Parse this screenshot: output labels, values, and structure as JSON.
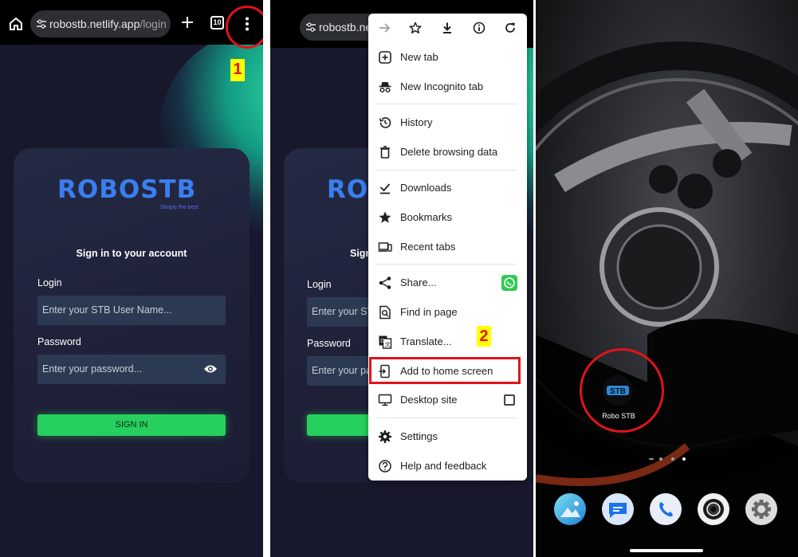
{
  "panel1": {
    "url_host": "robostb.netlify.app",
    "url_path": "/login",
    "tab_count": "10",
    "step_number": "1",
    "logo_text": "ROBOSTB",
    "tagline": "Simply the best",
    "signin_title": "Sign in to your account",
    "login_label": "Login",
    "login_placeholder": "Enter your STB User Name...",
    "password_label": "Password",
    "password_placeholder": "Enter your password...",
    "signin_button": "SIGN IN"
  },
  "panel2": {
    "url_text": "robostb.ne",
    "logo_partial": "RO",
    "signin_partial": "Sign",
    "login_label": "Login",
    "login_placeholder": "Enter your ST",
    "password_label": "Password",
    "password_placeholder": "Enter your pa",
    "step_number": "2",
    "menu_items": [
      {
        "label": "New tab",
        "icon": "plus-box-icon"
      },
      {
        "label": "New Incognito tab",
        "icon": "incognito-icon"
      },
      {
        "label": "History",
        "icon": "history-icon"
      },
      {
        "label": "Delete browsing data",
        "icon": "trash-icon"
      },
      {
        "label": "Downloads",
        "icon": "download-done-icon"
      },
      {
        "label": "Bookmarks",
        "icon": "star-filled-icon"
      },
      {
        "label": "Recent tabs",
        "icon": "devices-icon"
      },
      {
        "label": "Share...",
        "icon": "share-icon"
      },
      {
        "label": "Find in page",
        "icon": "find-page-icon"
      },
      {
        "label": "Translate...",
        "icon": "translate-icon"
      },
      {
        "label": "Add to home screen",
        "icon": "add-home-icon"
      },
      {
        "label": "Desktop site",
        "icon": "monitor-icon"
      },
      {
        "label": "Settings",
        "icon": "gear-icon"
      },
      {
        "label": "Help and feedback",
        "icon": "help-icon"
      }
    ]
  },
  "panel3": {
    "app_icon_text": "STB",
    "app_label": "Robo STB"
  },
  "colors": {
    "highlight_red": "#e0141a",
    "badge_yellow": "#ffff00",
    "signin_green": "#26d05e",
    "logo_blue": "#3a7ef0"
  }
}
